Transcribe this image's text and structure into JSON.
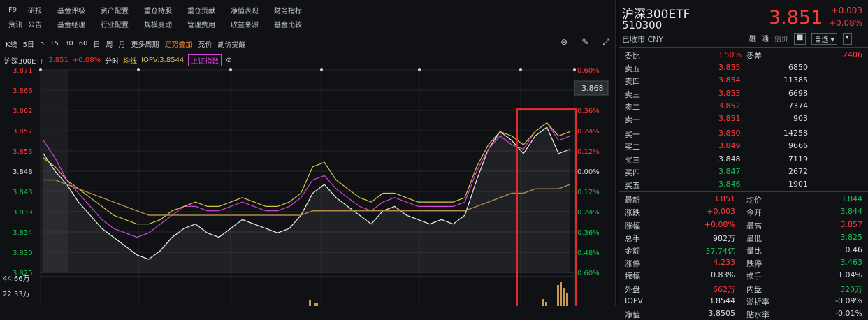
{
  "menu": {
    "row1": [
      "F9",
      "研报",
      "基金评级",
      "资产配置",
      "重仓持股",
      "重仓贡献",
      "净值表现",
      "财务指标"
    ],
    "row2": [
      "资讯",
      "公告",
      "基金经理",
      "行业配置",
      "规模变动",
      "管理费用",
      "收益来源",
      "基金比较"
    ]
  },
  "toolbar": {
    "items": [
      "K线",
      "5日",
      "5",
      "15",
      "30",
      "60",
      "日",
      "周",
      "月",
      "更多周期"
    ],
    "overlay": "走势叠加",
    "misc1": "竞价",
    "misc2": "副价提醒"
  },
  "chart_legend": {
    "name": "沪深300ETF",
    "price": "3.851",
    "pct": "+0.08%",
    "mode": "分时",
    "avg": "均线",
    "iopv": "IOPV:3.8544",
    "index": "上证指数"
  },
  "price_scale": [
    "3.871",
    "3.866",
    "3.862",
    "3.857",
    "3.853",
    "3.848",
    "3.843",
    "3.839",
    "3.834",
    "3.830",
    "3.825"
  ],
  "pct_scale": [
    "0.60%",
    "0.48%",
    "0.36%",
    "0.24%",
    "0.12%",
    "0.00%",
    "0.12%",
    "0.24%",
    "0.36%",
    "0.48%",
    "0.60%"
  ],
  "current_price_tag": "3.868",
  "volume_scale": [
    "44.66万",
    "22.33万"
  ],
  "chart_data": {
    "type": "line",
    "ylim": [
      3.825,
      3.871
    ],
    "series": [
      {
        "color": "#f0f0f0",
        "values": [
          3.852,
          3.848,
          3.845,
          3.841,
          3.838,
          3.835,
          3.833,
          3.831,
          3.829,
          3.828,
          3.83,
          3.833,
          3.835,
          3.836,
          3.834,
          3.833,
          3.835,
          3.837,
          3.836,
          3.835,
          3.834,
          3.835,
          3.838,
          3.843,
          3.845,
          3.842,
          3.84,
          3.838,
          3.836,
          3.839,
          3.84,
          3.838,
          3.837,
          3.836,
          3.837,
          3.836,
          3.838,
          3.846,
          3.853,
          3.857,
          3.855,
          3.852,
          3.856,
          3.858,
          3.852,
          3.853
        ]
      },
      {
        "color": "#d544d8",
        "values": [
          3.855,
          3.851,
          3.846,
          3.843,
          3.84,
          3.837,
          3.835,
          3.834,
          3.833,
          3.834,
          3.836,
          3.838,
          3.84,
          3.84,
          3.839,
          3.839,
          3.84,
          3.841,
          3.84,
          3.839,
          3.839,
          3.84,
          3.842,
          3.846,
          3.847,
          3.844,
          3.842,
          3.84,
          3.839,
          3.841,
          3.842,
          3.841,
          3.84,
          3.84,
          3.84,
          3.84,
          3.841,
          3.848,
          3.853,
          3.856,
          3.854,
          3.853,
          3.857,
          3.859,
          3.855,
          3.856
        ]
      },
      {
        "color": "#d8c64a",
        "values": [
          3.851,
          3.849,
          3.846,
          3.844,
          3.842,
          3.84,
          3.838,
          3.837,
          3.836,
          3.836,
          3.837,
          3.839,
          3.84,
          3.841,
          3.84,
          3.84,
          3.841,
          3.842,
          3.841,
          3.84,
          3.84,
          3.841,
          3.843,
          3.849,
          3.85,
          3.846,
          3.844,
          3.842,
          3.841,
          3.843,
          3.843,
          3.842,
          3.841,
          3.841,
          3.841,
          3.841,
          3.842,
          3.849,
          3.854,
          3.857,
          3.856,
          3.854,
          3.857,
          3.859,
          3.856,
          3.857
        ]
      },
      {
        "color": "#b08a4a",
        "values": [
          3.846,
          3.846,
          3.845,
          3.844,
          3.843,
          3.842,
          3.841,
          3.84,
          3.839,
          3.838,
          3.838,
          3.838,
          3.838,
          3.838,
          3.838,
          3.838,
          3.838,
          3.838,
          3.838,
          3.838,
          3.838,
          3.838,
          3.838,
          3.839,
          3.839,
          3.839,
          3.839,
          3.839,
          3.839,
          3.839,
          3.839,
          3.839,
          3.839,
          3.839,
          3.839,
          3.839,
          3.839,
          3.84,
          3.841,
          3.842,
          3.843,
          3.843,
          3.844,
          3.844,
          3.844,
          3.845
        ]
      }
    ]
  },
  "quote": {
    "name": "沪深300ETF",
    "code": "510300",
    "status": "已收市 CNY",
    "price": "3.851",
    "change": "+0.003",
    "pct": "+0.08%",
    "tool_labels": [
      "融",
      "通",
      "估价"
    ],
    "watch_button": "自选"
  },
  "order_head": {
    "label1": "委比",
    "val1": "3.50%",
    "label2": "委差",
    "val2": "2406"
  },
  "asks": [
    {
      "label": "卖五",
      "price": "3.855",
      "vol": "6850"
    },
    {
      "label": "卖四",
      "price": "3.854",
      "vol": "11385"
    },
    {
      "label": "卖三",
      "price": "3.853",
      "vol": "6698"
    },
    {
      "label": "卖二",
      "price": "3.852",
      "vol": "7374"
    },
    {
      "label": "卖一",
      "price": "3.851",
      "vol": "903"
    }
  ],
  "bids": [
    {
      "label": "买一",
      "price": "3.850",
      "vol": "14258",
      "color": "red"
    },
    {
      "label": "买二",
      "price": "3.849",
      "vol": "9666",
      "color": "red"
    },
    {
      "label": "买三",
      "price": "3.848",
      "vol": "7119",
      "color": "white"
    },
    {
      "label": "买四",
      "price": "3.847",
      "vol": "2672",
      "color": "green"
    },
    {
      "label": "买五",
      "price": "3.846",
      "vol": "1901",
      "color": "green"
    }
  ],
  "stats": [
    {
      "l1": "最新",
      "v1": "3.851",
      "c1": "red",
      "l2": "均价",
      "v2": "3.844",
      "c2": "green"
    },
    {
      "l1": "涨跌",
      "v1": "+0.003",
      "c1": "red",
      "l2": "今开",
      "v2": "3.844",
      "c2": "green"
    },
    {
      "l1": "涨幅",
      "v1": "+0.08%",
      "c1": "red",
      "l2": "最高",
      "v2": "3.857",
      "c2": "red"
    },
    {
      "l1": "总手",
      "v1": "982万",
      "c1": "white",
      "l2": "最低",
      "v2": "3.825",
      "c2": "green"
    },
    {
      "l1": "金额",
      "v1": "37.74亿",
      "c1": "green",
      "l2": "量比",
      "v2": "0.46",
      "c2": "white"
    },
    {
      "l1": "涨停",
      "v1": "4.233",
      "c1": "red",
      "l2": "跌停",
      "v2": "3.463",
      "c2": "green"
    },
    {
      "l1": "振幅",
      "v1": "0.83%",
      "c1": "white",
      "l2": "换手",
      "v2": "1.04%",
      "c2": "white"
    },
    {
      "l1": "外盘",
      "v1": "662万",
      "c1": "red",
      "l2": "内盘",
      "v2": "320万",
      "c2": "green"
    },
    {
      "l1": "IOPV",
      "v1": "3.8544",
      "c1": "white",
      "l2": "溢折率",
      "v2": "-0.09%",
      "c2": "white"
    },
    {
      "l1": "净值",
      "v1": "3.8505",
      "c1": "white",
      "l2": "贴水率",
      "v2": "-0.01%",
      "c2": "white"
    }
  ]
}
